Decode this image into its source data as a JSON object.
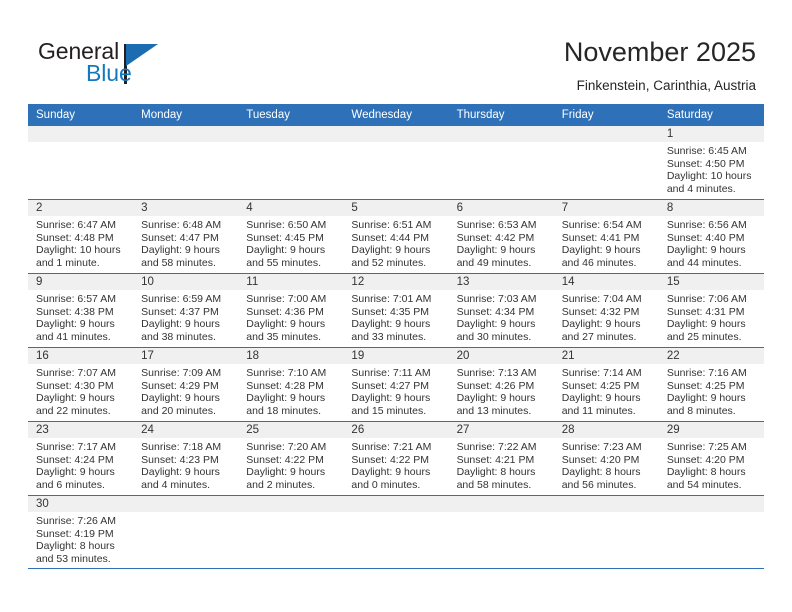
{
  "brand": {
    "name_part1": "General",
    "name_part2": "Blue",
    "logo_icon": "triangle-flag-icon",
    "accent_color": "#1378be",
    "header_color": "#2e71b8"
  },
  "header": {
    "title": "November 2025",
    "location": "Finkenstein, Carinthia, Austria"
  },
  "weekday_headers": [
    "Sunday",
    "Monday",
    "Tuesday",
    "Wednesday",
    "Thursday",
    "Friday",
    "Saturday"
  ],
  "weeks": [
    [
      {
        "day": "",
        "blank": true
      },
      {
        "day": "",
        "blank": true
      },
      {
        "day": "",
        "blank": true
      },
      {
        "day": "",
        "blank": true
      },
      {
        "day": "",
        "blank": true
      },
      {
        "day": "",
        "blank": true
      },
      {
        "day": "1",
        "sunrise": "Sunrise: 6:45 AM",
        "sunset": "Sunset: 4:50 PM",
        "daylight1": "Daylight: 10 hours",
        "daylight2": "and 4 minutes."
      }
    ],
    [
      {
        "day": "2",
        "sunrise": "Sunrise: 6:47 AM",
        "sunset": "Sunset: 4:48 PM",
        "daylight1": "Daylight: 10 hours",
        "daylight2": "and 1 minute."
      },
      {
        "day": "3",
        "sunrise": "Sunrise: 6:48 AM",
        "sunset": "Sunset: 4:47 PM",
        "daylight1": "Daylight: 9 hours",
        "daylight2": "and 58 minutes."
      },
      {
        "day": "4",
        "sunrise": "Sunrise: 6:50 AM",
        "sunset": "Sunset: 4:45 PM",
        "daylight1": "Daylight: 9 hours",
        "daylight2": "and 55 minutes."
      },
      {
        "day": "5",
        "sunrise": "Sunrise: 6:51 AM",
        "sunset": "Sunset: 4:44 PM",
        "daylight1": "Daylight: 9 hours",
        "daylight2": "and 52 minutes."
      },
      {
        "day": "6",
        "sunrise": "Sunrise: 6:53 AM",
        "sunset": "Sunset: 4:42 PM",
        "daylight1": "Daylight: 9 hours",
        "daylight2": "and 49 minutes."
      },
      {
        "day": "7",
        "sunrise": "Sunrise: 6:54 AM",
        "sunset": "Sunset: 4:41 PM",
        "daylight1": "Daylight: 9 hours",
        "daylight2": "and 46 minutes."
      },
      {
        "day": "8",
        "sunrise": "Sunrise: 6:56 AM",
        "sunset": "Sunset: 4:40 PM",
        "daylight1": "Daylight: 9 hours",
        "daylight2": "and 44 minutes."
      }
    ],
    [
      {
        "day": "9",
        "sunrise": "Sunrise: 6:57 AM",
        "sunset": "Sunset: 4:38 PM",
        "daylight1": "Daylight: 9 hours",
        "daylight2": "and 41 minutes."
      },
      {
        "day": "10",
        "sunrise": "Sunrise: 6:59 AM",
        "sunset": "Sunset: 4:37 PM",
        "daylight1": "Daylight: 9 hours",
        "daylight2": "and 38 minutes."
      },
      {
        "day": "11",
        "sunrise": "Sunrise: 7:00 AM",
        "sunset": "Sunset: 4:36 PM",
        "daylight1": "Daylight: 9 hours",
        "daylight2": "and 35 minutes."
      },
      {
        "day": "12",
        "sunrise": "Sunrise: 7:01 AM",
        "sunset": "Sunset: 4:35 PM",
        "daylight1": "Daylight: 9 hours",
        "daylight2": "and 33 minutes."
      },
      {
        "day": "13",
        "sunrise": "Sunrise: 7:03 AM",
        "sunset": "Sunset: 4:34 PM",
        "daylight1": "Daylight: 9 hours",
        "daylight2": "and 30 minutes."
      },
      {
        "day": "14",
        "sunrise": "Sunrise: 7:04 AM",
        "sunset": "Sunset: 4:32 PM",
        "daylight1": "Daylight: 9 hours",
        "daylight2": "and 27 minutes."
      },
      {
        "day": "15",
        "sunrise": "Sunrise: 7:06 AM",
        "sunset": "Sunset: 4:31 PM",
        "daylight1": "Daylight: 9 hours",
        "daylight2": "and 25 minutes."
      }
    ],
    [
      {
        "day": "16",
        "sunrise": "Sunrise: 7:07 AM",
        "sunset": "Sunset: 4:30 PM",
        "daylight1": "Daylight: 9 hours",
        "daylight2": "and 22 minutes."
      },
      {
        "day": "17",
        "sunrise": "Sunrise: 7:09 AM",
        "sunset": "Sunset: 4:29 PM",
        "daylight1": "Daylight: 9 hours",
        "daylight2": "and 20 minutes."
      },
      {
        "day": "18",
        "sunrise": "Sunrise: 7:10 AM",
        "sunset": "Sunset: 4:28 PM",
        "daylight1": "Daylight: 9 hours",
        "daylight2": "and 18 minutes."
      },
      {
        "day": "19",
        "sunrise": "Sunrise: 7:11 AM",
        "sunset": "Sunset: 4:27 PM",
        "daylight1": "Daylight: 9 hours",
        "daylight2": "and 15 minutes."
      },
      {
        "day": "20",
        "sunrise": "Sunrise: 7:13 AM",
        "sunset": "Sunset: 4:26 PM",
        "daylight1": "Daylight: 9 hours",
        "daylight2": "and 13 minutes."
      },
      {
        "day": "21",
        "sunrise": "Sunrise: 7:14 AM",
        "sunset": "Sunset: 4:25 PM",
        "daylight1": "Daylight: 9 hours",
        "daylight2": "and 11 minutes."
      },
      {
        "day": "22",
        "sunrise": "Sunrise: 7:16 AM",
        "sunset": "Sunset: 4:25 PM",
        "daylight1": "Daylight: 9 hours",
        "daylight2": "and 8 minutes."
      }
    ],
    [
      {
        "day": "23",
        "sunrise": "Sunrise: 7:17 AM",
        "sunset": "Sunset: 4:24 PM",
        "daylight1": "Daylight: 9 hours",
        "daylight2": "and 6 minutes."
      },
      {
        "day": "24",
        "sunrise": "Sunrise: 7:18 AM",
        "sunset": "Sunset: 4:23 PM",
        "daylight1": "Daylight: 9 hours",
        "daylight2": "and 4 minutes."
      },
      {
        "day": "25",
        "sunrise": "Sunrise: 7:20 AM",
        "sunset": "Sunset: 4:22 PM",
        "daylight1": "Daylight: 9 hours",
        "daylight2": "and 2 minutes."
      },
      {
        "day": "26",
        "sunrise": "Sunrise: 7:21 AM",
        "sunset": "Sunset: 4:22 PM",
        "daylight1": "Daylight: 9 hours",
        "daylight2": "and 0 minutes."
      },
      {
        "day": "27",
        "sunrise": "Sunrise: 7:22 AM",
        "sunset": "Sunset: 4:21 PM",
        "daylight1": "Daylight: 8 hours",
        "daylight2": "and 58 minutes."
      },
      {
        "day": "28",
        "sunrise": "Sunrise: 7:23 AM",
        "sunset": "Sunset: 4:20 PM",
        "daylight1": "Daylight: 8 hours",
        "daylight2": "and 56 minutes."
      },
      {
        "day": "29",
        "sunrise": "Sunrise: 7:25 AM",
        "sunset": "Sunset: 4:20 PM",
        "daylight1": "Daylight: 8 hours",
        "daylight2": "and 54 minutes."
      }
    ],
    [
      {
        "day": "30",
        "sunrise": "Sunrise: 7:26 AM",
        "sunset": "Sunset: 4:19 PM",
        "daylight1": "Daylight: 8 hours",
        "daylight2": "and 53 minutes."
      },
      {
        "day": "",
        "blank": true
      },
      {
        "day": "",
        "blank": true
      },
      {
        "day": "",
        "blank": true
      },
      {
        "day": "",
        "blank": true
      },
      {
        "day": "",
        "blank": true
      },
      {
        "day": "",
        "blank": true
      }
    ]
  ]
}
